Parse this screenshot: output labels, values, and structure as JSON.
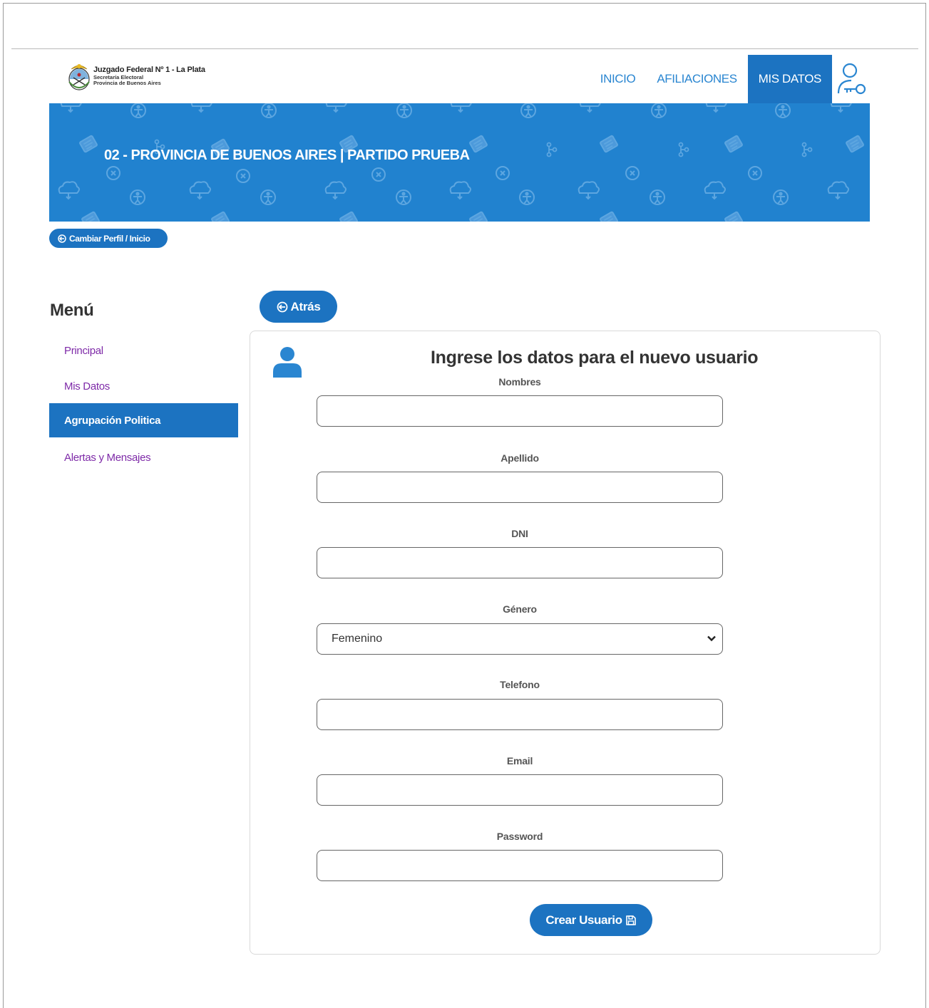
{
  "header": {
    "brand_title": "Juzgado Federal Nº 1 - La Plata",
    "brand_sub1": "Secretaría Electoral",
    "brand_sub2": "Provincia de Buenos Aires",
    "nav": [
      {
        "label": "INICIO"
      },
      {
        "label": "AFILIACIONES"
      },
      {
        "label": "MIS DATOS",
        "active": true
      }
    ],
    "user_icon": "user-key-icon"
  },
  "banner": {
    "title": "02 - PROVINCIA DE BUENOS AIRES | PARTIDO PRUEBA"
  },
  "profile_button": {
    "label": "Cambiar Perfil / Inicio",
    "icon": "arrow-circle-left-icon"
  },
  "sidebar": {
    "title": "Menú",
    "items": [
      {
        "label": "Principal"
      },
      {
        "label": "Mis Datos"
      },
      {
        "label": "Agrupación Politica",
        "active": true
      },
      {
        "label": "Alertas y Mensajes"
      }
    ]
  },
  "back_button": {
    "label": "Atrás",
    "icon": "arrow-circle-left-icon"
  },
  "form": {
    "title": "Ingrese los datos para el nuevo usuario",
    "icon": "user-icon",
    "fields": {
      "nombres": {
        "label": "Nombres",
        "value": ""
      },
      "apellido": {
        "label": "Apellido",
        "value": ""
      },
      "dni": {
        "label": "DNI",
        "value": ""
      },
      "genero": {
        "label": "Género",
        "value": "Femenino"
      },
      "telefono": {
        "label": "Telefono",
        "value": ""
      },
      "email": {
        "label": "Email",
        "value": ""
      },
      "password": {
        "label": "Password",
        "value": ""
      }
    },
    "submit": {
      "label": "Crear Usuario",
      "icon": "floppy-disk-icon"
    }
  },
  "colors": {
    "primary": "#1c73c1",
    "banner": "#2182cf",
    "link_purple": "#7e2aa8",
    "nav_text": "#2a86d1"
  }
}
